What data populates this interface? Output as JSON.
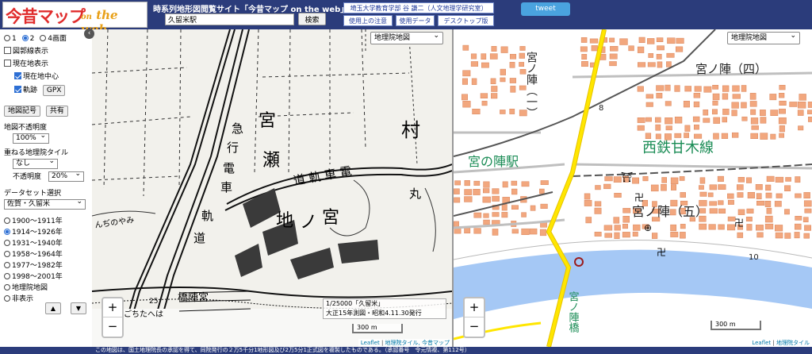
{
  "header": {
    "logo_text_jp": "今昔マップ",
    "logo_text_en_on": "on",
    "logo_text_en_web": "the web",
    "site_title": "時系列地形図閲覧サイト「今昔マップ on the web」",
    "search": {
      "value": "久留米駅",
      "button_label": "検索"
    },
    "author_link": "埼玉大学教育学部 谷 謙二（人文地理学研究室）",
    "links": {
      "notice": "使用上の注意",
      "data": "使用データ",
      "desktop": "デスクトップ版"
    },
    "tweet_label": "tweet"
  },
  "sidebar": {
    "collapse_icon": "chevron-left-icon",
    "screen_options": [
      "1",
      "2",
      "4画面"
    ],
    "screen_selected": "2",
    "checkboxes": [
      {
        "label": "図郭線表示",
        "checked": false
      },
      {
        "label": "現在地表示",
        "checked": false
      },
      {
        "label": "現在地中心",
        "checked": true
      },
      {
        "label": "軌跡",
        "checked": true
      }
    ],
    "gpx_label": "GPX",
    "map_symbol_label": "地図記号",
    "share_label": "共有",
    "opacity_label": "地図不透明度",
    "opacity_value": "100%",
    "overlay_label": "重ねる地理院タイル",
    "overlay_value": "なし",
    "overlay_opacity_label": "不透明度",
    "overlay_opacity_value": "20%",
    "dataset_label": "データセット選択",
    "dataset_value": "佐賀・久留米",
    "periods": [
      {
        "label": "1900〜1911年",
        "selected": false
      },
      {
        "label": "1914〜1926年",
        "selected": true
      },
      {
        "label": "1931〜1940年",
        "selected": false
      },
      {
        "label": "1958〜1964年",
        "selected": false
      },
      {
        "label": "1977〜1982年",
        "selected": false
      },
      {
        "label": "1998〜2001年",
        "selected": false
      },
      {
        "label": "地理院地図",
        "selected": false
      },
      {
        "label": "非表示",
        "selected": false
      }
    ],
    "up_icon": "triangle-up-icon",
    "down_icon": "triangle-down-icon",
    "up_glyph": "▲",
    "down_glyph": "▼"
  },
  "left_map": {
    "layer_select": "地理院地図",
    "zoom_in": "+",
    "zoom_out": "−",
    "info_line1": "1/25000「久留米」",
    "info_line2": "大正15年測図・昭和4.11.30発行",
    "scale": "300 m",
    "attribution_leaflet": "Leaflet",
    "attribution_tiles": "地理院タイル, 今昔マップ",
    "labels": {
      "miya": "宮",
      "se": "瀬",
      "mura": "村",
      "kyu": "急",
      "ko": "行",
      "den": "電",
      "sha": "車",
      "ki": "軌",
      "do": "道",
      "train_line": "道 軌 車 電",
      "maru": "丸",
      "chi": "地",
      "no": "ノ",
      "miya2": "宮",
      "bridge": "橋陣宮",
      "yami": "んぢのやみ",
      "gochi": "ごちたへは",
      "num25": "25"
    }
  },
  "right_map": {
    "layer_select": "地理院地図",
    "zoom_in": "+",
    "zoom_out": "−",
    "scale": "300 m",
    "attribution_leaflet": "Leaflet",
    "attribution_tiles": "地理院タイル",
    "labels": {
      "miyanojin_v": "宮ノ陣（一）",
      "miyanojin_4": "宮ノ陣（四）",
      "station": "宮の陣駅",
      "line": "西鉄甘木線",
      "miyanojin_5": "宮ノ陣（五）",
      "n8": "8",
      "n10": "10",
      "bridge_v": "宮ノ陣橋"
    },
    "colors": {
      "building": "#f2a77e",
      "water": "#a5c8f5",
      "road_yellow": "#ffe600",
      "rail": "#555555",
      "label_green": "#1a8c55"
    }
  },
  "footer": {
    "text": "この地図は、国土地理院長の承認を得て、同院発行の２万5千分1地形図及び2万5分1正式図を複製したものである。（承認番号　令元情複、第112号）"
  }
}
